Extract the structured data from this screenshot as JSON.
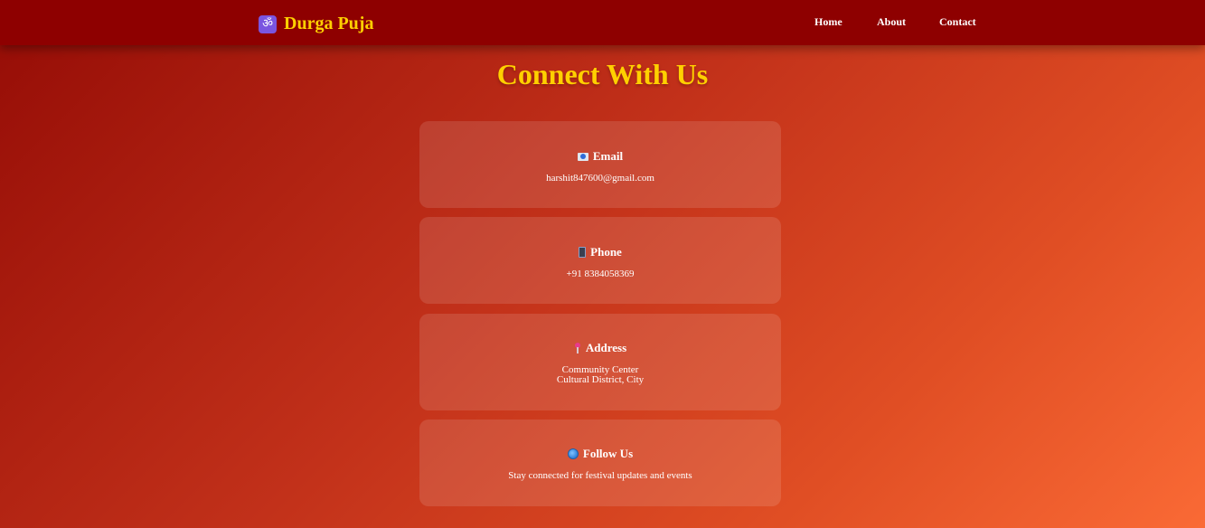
{
  "nav": {
    "brand": "Durga Puja",
    "brand_icon": "ॐ",
    "links": [
      "Home",
      "About",
      "Contact"
    ]
  },
  "heading": "Connect With Us",
  "cards": [
    {
      "title": "Email",
      "icon": "email-icon",
      "lines": [
        "harshit847600@gmail.com"
      ]
    },
    {
      "title": "Phone",
      "icon": "phone-icon",
      "lines": [
        "+91 8384058369"
      ]
    },
    {
      "title": "Address",
      "icon": "location-pin-icon",
      "lines": [
        "Community Center",
        "Cultural District, City"
      ]
    },
    {
      "title": "Follow Us",
      "icon": "globe-icon",
      "lines": [
        "Stay connected for festival updates and events"
      ]
    }
  ],
  "colors": {
    "navbar": "#8e0000",
    "accent": "#ffd000"
  }
}
